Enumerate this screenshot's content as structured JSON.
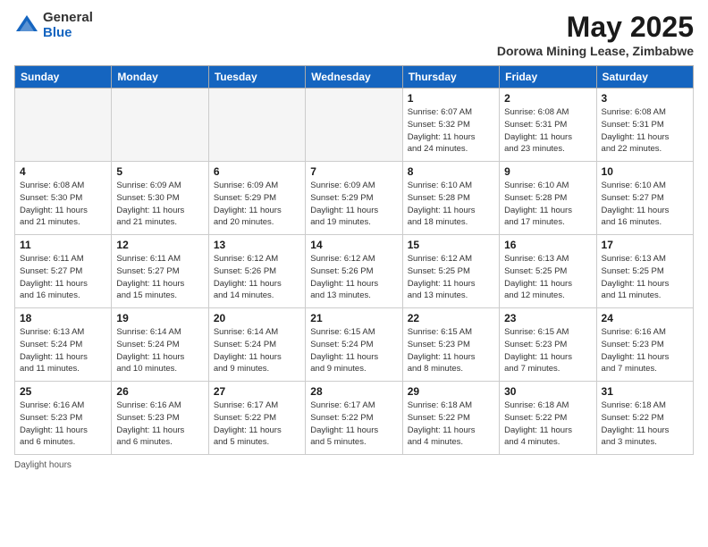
{
  "logo": {
    "general": "General",
    "blue": "Blue"
  },
  "title": {
    "month": "May 2025",
    "location": "Dorowa Mining Lease, Zimbabwe"
  },
  "days_of_week": [
    "Sunday",
    "Monday",
    "Tuesday",
    "Wednesday",
    "Thursday",
    "Friday",
    "Saturday"
  ],
  "footer": {
    "daylight": "Daylight hours"
  },
  "weeks": [
    [
      {
        "day": "",
        "info": ""
      },
      {
        "day": "",
        "info": ""
      },
      {
        "day": "",
        "info": ""
      },
      {
        "day": "",
        "info": ""
      },
      {
        "day": "1",
        "info": "Sunrise: 6:07 AM\nSunset: 5:32 PM\nDaylight: 11 hours\nand 24 minutes."
      },
      {
        "day": "2",
        "info": "Sunrise: 6:08 AM\nSunset: 5:31 PM\nDaylight: 11 hours\nand 23 minutes."
      },
      {
        "day": "3",
        "info": "Sunrise: 6:08 AM\nSunset: 5:31 PM\nDaylight: 11 hours\nand 22 minutes."
      }
    ],
    [
      {
        "day": "4",
        "info": "Sunrise: 6:08 AM\nSunset: 5:30 PM\nDaylight: 11 hours\nand 21 minutes."
      },
      {
        "day": "5",
        "info": "Sunrise: 6:09 AM\nSunset: 5:30 PM\nDaylight: 11 hours\nand 21 minutes."
      },
      {
        "day": "6",
        "info": "Sunrise: 6:09 AM\nSunset: 5:29 PM\nDaylight: 11 hours\nand 20 minutes."
      },
      {
        "day": "7",
        "info": "Sunrise: 6:09 AM\nSunset: 5:29 PM\nDaylight: 11 hours\nand 19 minutes."
      },
      {
        "day": "8",
        "info": "Sunrise: 6:10 AM\nSunset: 5:28 PM\nDaylight: 11 hours\nand 18 minutes."
      },
      {
        "day": "9",
        "info": "Sunrise: 6:10 AM\nSunset: 5:28 PM\nDaylight: 11 hours\nand 17 minutes."
      },
      {
        "day": "10",
        "info": "Sunrise: 6:10 AM\nSunset: 5:27 PM\nDaylight: 11 hours\nand 16 minutes."
      }
    ],
    [
      {
        "day": "11",
        "info": "Sunrise: 6:11 AM\nSunset: 5:27 PM\nDaylight: 11 hours\nand 16 minutes."
      },
      {
        "day": "12",
        "info": "Sunrise: 6:11 AM\nSunset: 5:27 PM\nDaylight: 11 hours\nand 15 minutes."
      },
      {
        "day": "13",
        "info": "Sunrise: 6:12 AM\nSunset: 5:26 PM\nDaylight: 11 hours\nand 14 minutes."
      },
      {
        "day": "14",
        "info": "Sunrise: 6:12 AM\nSunset: 5:26 PM\nDaylight: 11 hours\nand 13 minutes."
      },
      {
        "day": "15",
        "info": "Sunrise: 6:12 AM\nSunset: 5:25 PM\nDaylight: 11 hours\nand 13 minutes."
      },
      {
        "day": "16",
        "info": "Sunrise: 6:13 AM\nSunset: 5:25 PM\nDaylight: 11 hours\nand 12 minutes."
      },
      {
        "day": "17",
        "info": "Sunrise: 6:13 AM\nSunset: 5:25 PM\nDaylight: 11 hours\nand 11 minutes."
      }
    ],
    [
      {
        "day": "18",
        "info": "Sunrise: 6:13 AM\nSunset: 5:24 PM\nDaylight: 11 hours\nand 11 minutes."
      },
      {
        "day": "19",
        "info": "Sunrise: 6:14 AM\nSunset: 5:24 PM\nDaylight: 11 hours\nand 10 minutes."
      },
      {
        "day": "20",
        "info": "Sunrise: 6:14 AM\nSunset: 5:24 PM\nDaylight: 11 hours\nand 9 minutes."
      },
      {
        "day": "21",
        "info": "Sunrise: 6:15 AM\nSunset: 5:24 PM\nDaylight: 11 hours\nand 9 minutes."
      },
      {
        "day": "22",
        "info": "Sunrise: 6:15 AM\nSunset: 5:23 PM\nDaylight: 11 hours\nand 8 minutes."
      },
      {
        "day": "23",
        "info": "Sunrise: 6:15 AM\nSunset: 5:23 PM\nDaylight: 11 hours\nand 7 minutes."
      },
      {
        "day": "24",
        "info": "Sunrise: 6:16 AM\nSunset: 5:23 PM\nDaylight: 11 hours\nand 7 minutes."
      }
    ],
    [
      {
        "day": "25",
        "info": "Sunrise: 6:16 AM\nSunset: 5:23 PM\nDaylight: 11 hours\nand 6 minutes."
      },
      {
        "day": "26",
        "info": "Sunrise: 6:16 AM\nSunset: 5:23 PM\nDaylight: 11 hours\nand 6 minutes."
      },
      {
        "day": "27",
        "info": "Sunrise: 6:17 AM\nSunset: 5:22 PM\nDaylight: 11 hours\nand 5 minutes."
      },
      {
        "day": "28",
        "info": "Sunrise: 6:17 AM\nSunset: 5:22 PM\nDaylight: 11 hours\nand 5 minutes."
      },
      {
        "day": "29",
        "info": "Sunrise: 6:18 AM\nSunset: 5:22 PM\nDaylight: 11 hours\nand 4 minutes."
      },
      {
        "day": "30",
        "info": "Sunrise: 6:18 AM\nSunset: 5:22 PM\nDaylight: 11 hours\nand 4 minutes."
      },
      {
        "day": "31",
        "info": "Sunrise: 6:18 AM\nSunset: 5:22 PM\nDaylight: 11 hours\nand 3 minutes."
      }
    ]
  ]
}
